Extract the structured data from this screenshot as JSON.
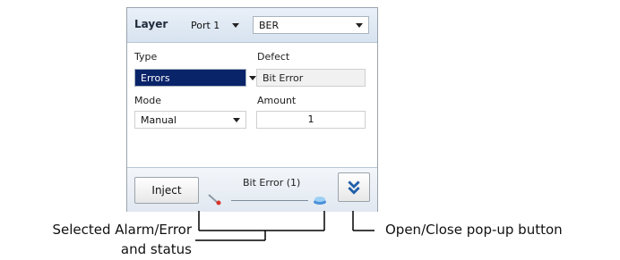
{
  "layer": {
    "label": "Layer",
    "port_select": "Port 1",
    "type_select": "BER"
  },
  "form": {
    "type_label": "Type",
    "type_value": "Errors",
    "defect_label": "Defect",
    "defect_value": "Bit Error",
    "mode_label": "Mode",
    "mode_value": "Manual",
    "amount_label": "Amount",
    "amount_value": "1"
  },
  "bottom": {
    "inject_label": "Inject",
    "status_text": "Bit Error (1)",
    "popup_icon": "double-chevron-down-icon"
  },
  "callouts": {
    "left_line1": "Selected Alarm/Error",
    "left_line2": "and status",
    "right": "Open/Close pop-up button"
  },
  "colors": {
    "selection": "#0a246a",
    "header_gradient_top": "#e9f0f8",
    "header_gradient_bottom": "#d7e3f0",
    "accent": "#1f5fa8"
  }
}
